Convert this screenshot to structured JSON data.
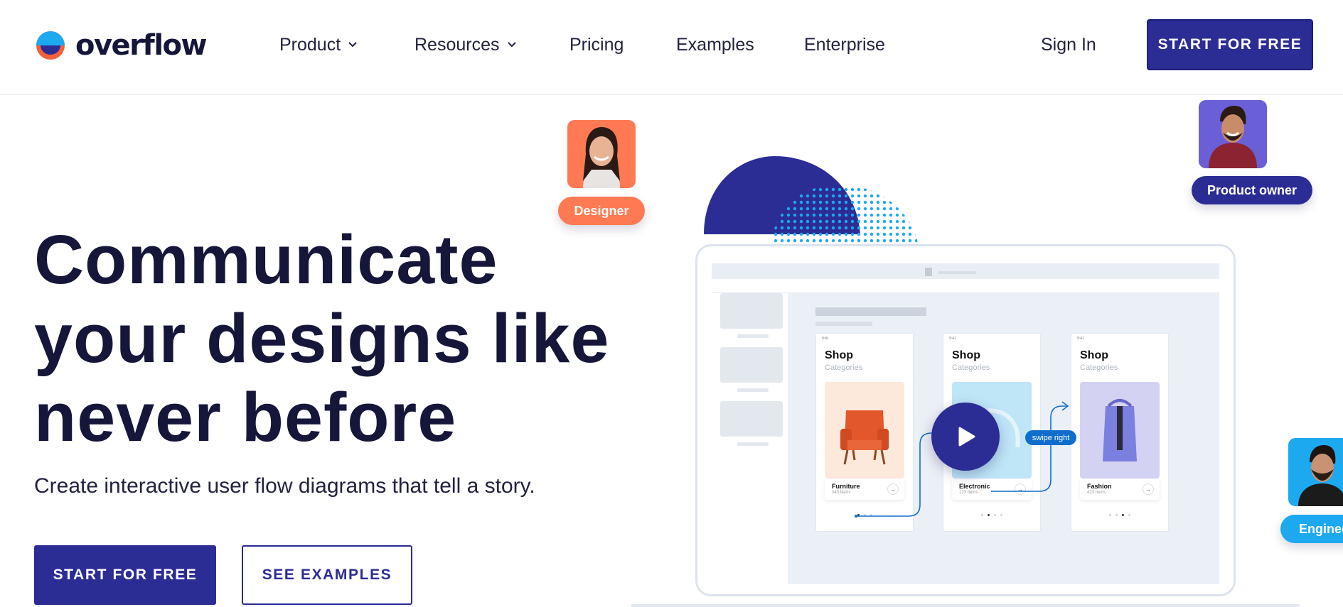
{
  "brand": {
    "name": "overflow",
    "colors": {
      "primary": "#2c2c95",
      "logo_top": "#1da9f0",
      "logo_bottom": "#f4603a",
      "heading": "#15163a"
    }
  },
  "nav": {
    "items": [
      {
        "label": "Product",
        "has_dropdown": true
      },
      {
        "label": "Resources",
        "has_dropdown": true
      },
      {
        "label": "Pricing",
        "has_dropdown": false
      },
      {
        "label": "Examples",
        "has_dropdown": false
      },
      {
        "label": "Enterprise",
        "has_dropdown": false
      }
    ],
    "sign_in": "Sign In",
    "cta": "START FOR FREE"
  },
  "hero": {
    "title_lines": [
      "Communicate",
      "your designs like",
      "never before"
    ],
    "subtitle": "Create interactive user flow diagrams that tell a story.",
    "primary_button": "START FOR FREE",
    "secondary_button": "SEE EXAMPLES"
  },
  "roles": [
    {
      "label": "Designer",
      "color": "#ff7a52"
    },
    {
      "label": "Product owner",
      "color": "#2c2c95"
    },
    {
      "label": "Enginee",
      "color": "#1da9f0"
    }
  ],
  "mockup": {
    "screens": [
      {
        "title": "Shop",
        "subtitle": "Categories",
        "category": "Furniture",
        "count": "340 Items",
        "time": "9:41",
        "image_bg": "#fde9dc",
        "active_dot": 0
      },
      {
        "title": "Shop",
        "subtitle": "Categories",
        "category": "Electronic",
        "count": "123 Items",
        "time": "9:41",
        "image_bg": "#bfe6f7",
        "active_dot": 1
      },
      {
        "title": "Shop",
        "subtitle": "Categories",
        "category": "Fashion",
        "count": "423 Items",
        "time": "9:41",
        "image_bg": "#d4d2f3",
        "active_dot": 2
      }
    ],
    "swipe_label": "swipe right",
    "play_icon": "play-icon",
    "card_arrow": "→"
  }
}
